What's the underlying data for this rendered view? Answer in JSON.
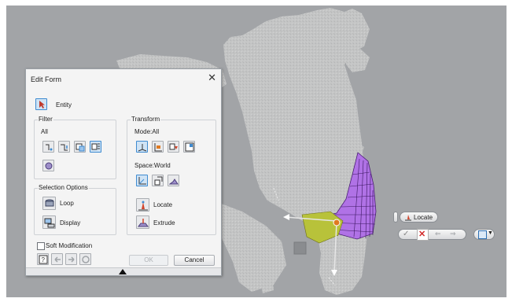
{
  "dialog": {
    "title": "Edit Form",
    "entity_label": "Entity",
    "filter": {
      "title": "Filter",
      "subtitle": "All"
    },
    "transform": {
      "title": "Transform",
      "mode": "Mode:All",
      "space": "Space:World",
      "locate": "Locate",
      "extrude": "Extrude"
    },
    "selection": {
      "title": "Selection Options",
      "loop": "Loop",
      "display": "Display"
    },
    "soft_modification": "Soft Modification",
    "ok_label": "OK",
    "cancel_label": "Cancel"
  },
  "viewport_overlay": {
    "locate_label": "Locate"
  },
  "colors": {
    "viewport": "#a2a4a7",
    "scan": "#c3c4c4",
    "mesh": "#a857e0",
    "accent": "#3f8bd0",
    "cancel_red": "#d22b2b"
  }
}
